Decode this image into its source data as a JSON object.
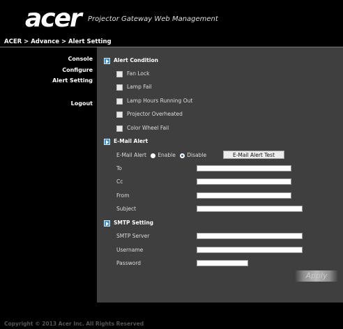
{
  "header": {
    "logo": "acer",
    "title": "Projector Gateway Web Management"
  },
  "breadcrumb": "ACER > Advance > Alert Setting",
  "sidebar": {
    "items": [
      {
        "label": "Console"
      },
      {
        "label": "Configure"
      },
      {
        "label": "Alert Setting"
      },
      {
        "label": "Logout"
      }
    ]
  },
  "alert_condition": {
    "title": "Alert Condition",
    "items": [
      {
        "label": "Fan Lock"
      },
      {
        "label": "Lamp Fail"
      },
      {
        "label": "Lamp Hours Running Out"
      },
      {
        "label": "Projector Overheated"
      },
      {
        "label": "Color Wheel Fail"
      }
    ]
  },
  "email_alert": {
    "title": "E-Mail Alert",
    "label": "E-Mail Alert",
    "enable_label": "Enable",
    "disable_label": "Disable",
    "selected": "Disable",
    "test_button": "E-Mail Alert Test",
    "to_label": "To",
    "to_value": "",
    "cc_label": "Cc",
    "cc_value": "",
    "from_label": "From",
    "from_value": "",
    "subject_label": "Subject",
    "subject_value": ""
  },
  "smtp": {
    "title": "SMTP Setting",
    "server_label": "SMTP Server",
    "server_value": "",
    "username_label": "Username",
    "username_value": "",
    "password_label": "Password",
    "password_value": ""
  },
  "apply_label": "Apply",
  "footer": {
    "copyright": "Copyright © 2013 Acer Inc. All Rights Reserved"
  },
  "colors": {
    "main_bg": "#3f3f3f",
    "icon_blue": "#3a8fd0",
    "page_bg": "#000000"
  }
}
